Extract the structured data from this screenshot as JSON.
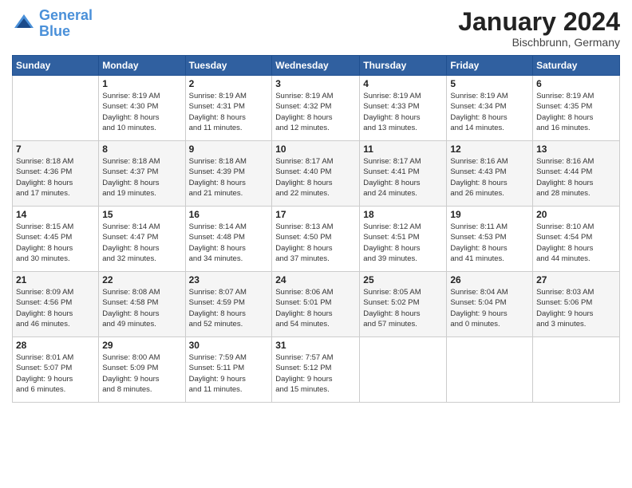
{
  "header": {
    "logo_line1": "General",
    "logo_line2": "Blue",
    "month_title": "January 2024",
    "location": "Bischbrunn, Germany"
  },
  "weekdays": [
    "Sunday",
    "Monday",
    "Tuesday",
    "Wednesday",
    "Thursday",
    "Friday",
    "Saturday"
  ],
  "weeks": [
    [
      {
        "day": "",
        "info": ""
      },
      {
        "day": "1",
        "info": "Sunrise: 8:19 AM\nSunset: 4:30 PM\nDaylight: 8 hours\nand 10 minutes."
      },
      {
        "day": "2",
        "info": "Sunrise: 8:19 AM\nSunset: 4:31 PM\nDaylight: 8 hours\nand 11 minutes."
      },
      {
        "day": "3",
        "info": "Sunrise: 8:19 AM\nSunset: 4:32 PM\nDaylight: 8 hours\nand 12 minutes."
      },
      {
        "day": "4",
        "info": "Sunrise: 8:19 AM\nSunset: 4:33 PM\nDaylight: 8 hours\nand 13 minutes."
      },
      {
        "day": "5",
        "info": "Sunrise: 8:19 AM\nSunset: 4:34 PM\nDaylight: 8 hours\nand 14 minutes."
      },
      {
        "day": "6",
        "info": "Sunrise: 8:19 AM\nSunset: 4:35 PM\nDaylight: 8 hours\nand 16 minutes."
      }
    ],
    [
      {
        "day": "7",
        "info": "Sunrise: 8:18 AM\nSunset: 4:36 PM\nDaylight: 8 hours\nand 17 minutes."
      },
      {
        "day": "8",
        "info": "Sunrise: 8:18 AM\nSunset: 4:37 PM\nDaylight: 8 hours\nand 19 minutes."
      },
      {
        "day": "9",
        "info": "Sunrise: 8:18 AM\nSunset: 4:39 PM\nDaylight: 8 hours\nand 21 minutes."
      },
      {
        "day": "10",
        "info": "Sunrise: 8:17 AM\nSunset: 4:40 PM\nDaylight: 8 hours\nand 22 minutes."
      },
      {
        "day": "11",
        "info": "Sunrise: 8:17 AM\nSunset: 4:41 PM\nDaylight: 8 hours\nand 24 minutes."
      },
      {
        "day": "12",
        "info": "Sunrise: 8:16 AM\nSunset: 4:43 PM\nDaylight: 8 hours\nand 26 minutes."
      },
      {
        "day": "13",
        "info": "Sunrise: 8:16 AM\nSunset: 4:44 PM\nDaylight: 8 hours\nand 28 minutes."
      }
    ],
    [
      {
        "day": "14",
        "info": "Sunrise: 8:15 AM\nSunset: 4:45 PM\nDaylight: 8 hours\nand 30 minutes."
      },
      {
        "day": "15",
        "info": "Sunrise: 8:14 AM\nSunset: 4:47 PM\nDaylight: 8 hours\nand 32 minutes."
      },
      {
        "day": "16",
        "info": "Sunrise: 8:14 AM\nSunset: 4:48 PM\nDaylight: 8 hours\nand 34 minutes."
      },
      {
        "day": "17",
        "info": "Sunrise: 8:13 AM\nSunset: 4:50 PM\nDaylight: 8 hours\nand 37 minutes."
      },
      {
        "day": "18",
        "info": "Sunrise: 8:12 AM\nSunset: 4:51 PM\nDaylight: 8 hours\nand 39 minutes."
      },
      {
        "day": "19",
        "info": "Sunrise: 8:11 AM\nSunset: 4:53 PM\nDaylight: 8 hours\nand 41 minutes."
      },
      {
        "day": "20",
        "info": "Sunrise: 8:10 AM\nSunset: 4:54 PM\nDaylight: 8 hours\nand 44 minutes."
      }
    ],
    [
      {
        "day": "21",
        "info": "Sunrise: 8:09 AM\nSunset: 4:56 PM\nDaylight: 8 hours\nand 46 minutes."
      },
      {
        "day": "22",
        "info": "Sunrise: 8:08 AM\nSunset: 4:58 PM\nDaylight: 8 hours\nand 49 minutes."
      },
      {
        "day": "23",
        "info": "Sunrise: 8:07 AM\nSunset: 4:59 PM\nDaylight: 8 hours\nand 52 minutes."
      },
      {
        "day": "24",
        "info": "Sunrise: 8:06 AM\nSunset: 5:01 PM\nDaylight: 8 hours\nand 54 minutes."
      },
      {
        "day": "25",
        "info": "Sunrise: 8:05 AM\nSunset: 5:02 PM\nDaylight: 8 hours\nand 57 minutes."
      },
      {
        "day": "26",
        "info": "Sunrise: 8:04 AM\nSunset: 5:04 PM\nDaylight: 9 hours\nand 0 minutes."
      },
      {
        "day": "27",
        "info": "Sunrise: 8:03 AM\nSunset: 5:06 PM\nDaylight: 9 hours\nand 3 minutes."
      }
    ],
    [
      {
        "day": "28",
        "info": "Sunrise: 8:01 AM\nSunset: 5:07 PM\nDaylight: 9 hours\nand 6 minutes."
      },
      {
        "day": "29",
        "info": "Sunrise: 8:00 AM\nSunset: 5:09 PM\nDaylight: 9 hours\nand 8 minutes."
      },
      {
        "day": "30",
        "info": "Sunrise: 7:59 AM\nSunset: 5:11 PM\nDaylight: 9 hours\nand 11 minutes."
      },
      {
        "day": "31",
        "info": "Sunrise: 7:57 AM\nSunset: 5:12 PM\nDaylight: 9 hours\nand 15 minutes."
      },
      {
        "day": "",
        "info": ""
      },
      {
        "day": "",
        "info": ""
      },
      {
        "day": "",
        "info": ""
      }
    ]
  ]
}
